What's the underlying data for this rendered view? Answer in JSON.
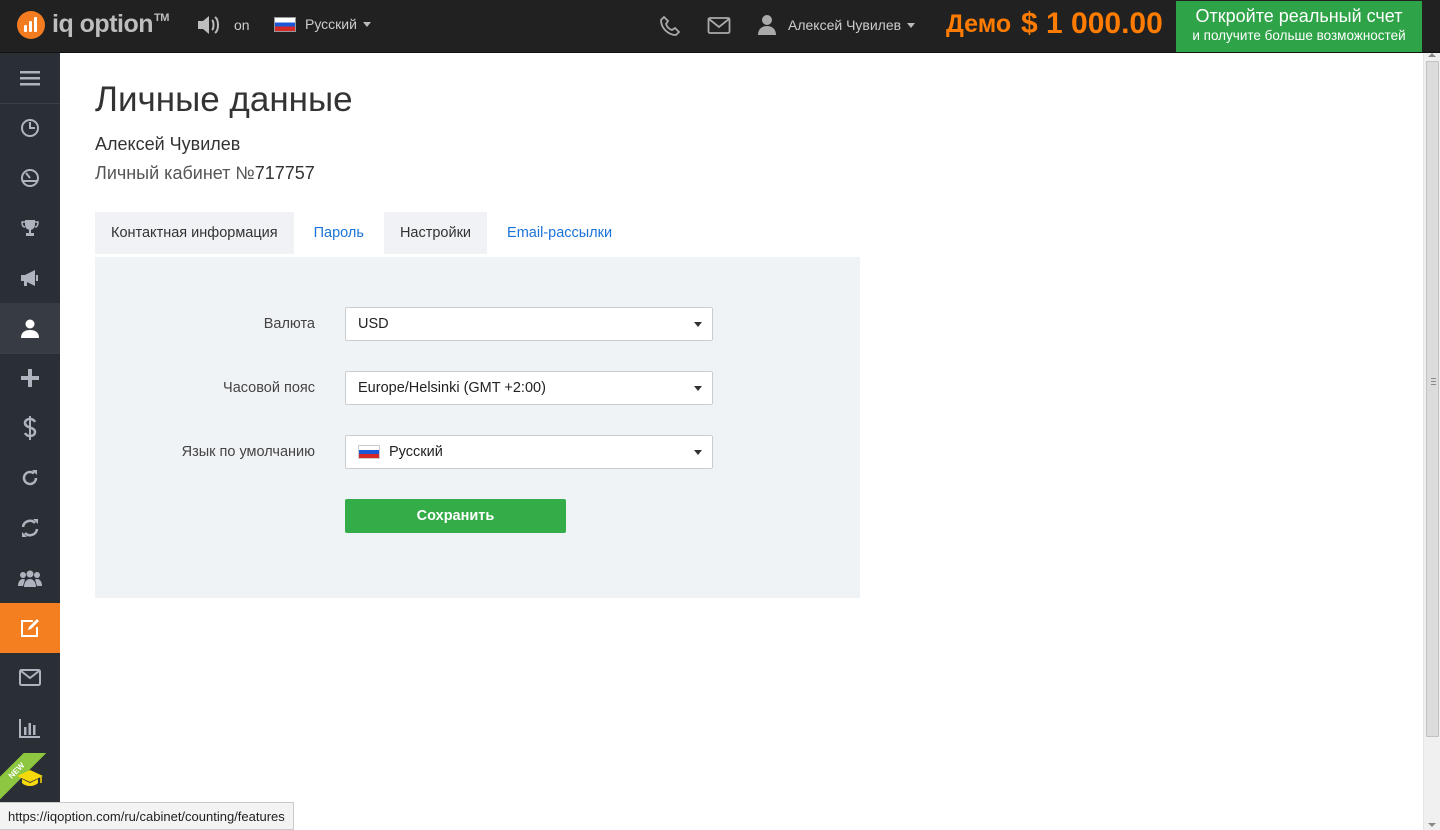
{
  "header": {
    "logo_text": "iq option",
    "logo_tm": "TM",
    "sound_label": "on",
    "language": "Русский",
    "user_name": "Алексей Чувилев",
    "account_mode": "Демо",
    "balance": "$ 1 000.00",
    "cta_main": "Откройте реальный счет",
    "cta_sub": "и получите больше возможностей"
  },
  "sidebar": {
    "items": [
      {
        "icon": "menu-icon"
      },
      {
        "icon": "clock-icon"
      },
      {
        "icon": "gauge-icon"
      },
      {
        "icon": "trophy-icon"
      },
      {
        "icon": "megaphone-icon"
      },
      {
        "icon": "user-icon"
      },
      {
        "icon": "plus-icon"
      },
      {
        "icon": "dollar-icon"
      },
      {
        "icon": "refresh-icon"
      },
      {
        "icon": "sync-icon"
      },
      {
        "icon": "group-icon"
      },
      {
        "icon": "edit-icon"
      },
      {
        "icon": "envelope-icon"
      },
      {
        "icon": "bar-chart-icon"
      },
      {
        "icon": "graduation-cap-icon"
      }
    ],
    "new_badge": "NEW"
  },
  "main": {
    "title": "Личные данные",
    "user_name": "Алексей Чувилев",
    "cabinet_label": "Личный кабинет №",
    "cabinet_number": "717757",
    "tabs": [
      {
        "label": "Контактная информация"
      },
      {
        "label": "Пароль"
      },
      {
        "label": "Настройки"
      },
      {
        "label": "Email-рассылки"
      }
    ],
    "form": {
      "currency_label": "Валюта",
      "currency_value": "USD",
      "timezone_label": "Часовой пояс",
      "timezone_value": "Europe/Helsinki (GMT +2:00)",
      "language_label": "Язык по умолчанию",
      "language_value": "Русский",
      "save_label": "Сохранить"
    }
  },
  "status_bar": {
    "url": "https://iqoption.com/ru/cabinet/counting/features"
  },
  "colors": {
    "accent": "#ff7c00",
    "cta_green": "#2ea347",
    "save_green": "#34ad48",
    "link_blue": "#1a73d9",
    "sidebar_bg": "#2a2e35",
    "topbar_bg": "#212121"
  }
}
